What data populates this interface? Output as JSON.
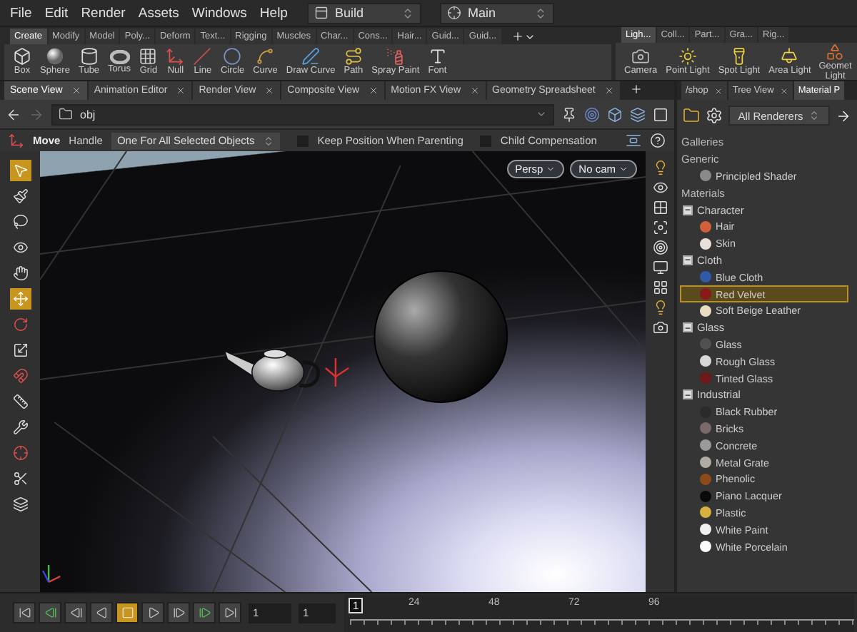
{
  "menu": [
    "File",
    "Edit",
    "Render",
    "Assets",
    "Windows",
    "Help"
  ],
  "dropdowns": [
    {
      "label": "Build"
    },
    {
      "label": "Main"
    }
  ],
  "shelf_tabs": [
    {
      "label": "Create",
      "selected": true
    },
    {
      "label": "Modify",
      "selected": false
    },
    {
      "label": "Model",
      "selected": false
    },
    {
      "label": "Poly...",
      "selected": false
    },
    {
      "label": "Deform",
      "selected": false
    },
    {
      "label": "Text...",
      "selected": false
    },
    {
      "label": "Rigging",
      "selected": false
    },
    {
      "label": "Muscles",
      "selected": false
    },
    {
      "label": "Char...",
      "selected": false
    },
    {
      "label": "Cons...",
      "selected": false
    },
    {
      "label": "Hair...",
      "selected": false
    },
    {
      "label": "Guid...",
      "selected": false
    },
    {
      "label": "Guid...",
      "selected": false
    }
  ],
  "shelf_tools": [
    "Box",
    "Sphere",
    "Tube",
    "Torus",
    "Grid",
    "Null",
    "Line",
    "Circle",
    "Curve",
    "Draw Curve",
    "Path",
    "Spray Paint",
    "Font"
  ],
  "light_shelf_tabs": [
    {
      "label": "Ligh...",
      "selected": true
    },
    {
      "label": "Coll...",
      "selected": false
    },
    {
      "label": "Part...",
      "selected": false
    },
    {
      "label": "Gra...",
      "selected": false
    },
    {
      "label": "Rig...",
      "selected": false
    }
  ],
  "light_tools": [
    "Camera",
    "Point Light",
    "Spot Light",
    "Area Light",
    "Geomet Light"
  ],
  "pane_tabs": [
    {
      "label": "Scene View",
      "selected": true
    },
    {
      "label": "Animation Editor",
      "selected": false
    },
    {
      "label": "Render View",
      "selected": false
    },
    {
      "label": "Composite View",
      "selected": false
    },
    {
      "label": "Motion FX View",
      "selected": false
    },
    {
      "label": "Geometry Spreadsheet",
      "selected": false
    }
  ],
  "path": "obj",
  "operation": {
    "tool": "Move",
    "handle_label": "Handle",
    "mode": "One For All Selected Objects",
    "options": [
      {
        "label": "Keep Position When Parenting",
        "checked": false
      },
      {
        "label": "Child Compensation",
        "checked": false
      }
    ]
  },
  "viewport_tools": [
    {
      "selected": true
    },
    {
      "selected": false
    },
    {
      "selected": false
    },
    {
      "selected": false
    },
    {
      "selected": false
    },
    {
      "selected": true
    },
    {
      "selected": false
    },
    {
      "selected": false
    },
    {
      "selected": false
    },
    {
      "selected": false
    },
    {
      "selected": false
    },
    {
      "selected": false
    },
    {
      "selected": false
    },
    {
      "selected": false
    }
  ],
  "view_buttons": [
    "Persp",
    "No cam"
  ],
  "side_pane": {
    "tabs": [
      {
        "label": "/shop",
        "selected": false
      },
      {
        "label": "Tree View",
        "selected": false
      },
      {
        "label": "Material P",
        "selected": true
      }
    ],
    "renderer": "All Renderers",
    "tree": [
      {
        "kind": "section",
        "label": "Galleries"
      },
      {
        "kind": "section",
        "label": "Generic",
        "children": [
          {
            "kind": "material",
            "label": "Principled Shader",
            "color": "#8a8a8a",
            "selected": false
          }
        ]
      },
      {
        "kind": "section",
        "label": "Materials",
        "children": [
          {
            "kind": "group",
            "label": "Character",
            "expanded": true,
            "children": [
              {
                "kind": "material",
                "label": "Hair",
                "color": "#d0603a",
                "selected": false
              },
              {
                "kind": "material",
                "label": "Skin",
                "color": "#e8e0d8",
                "selected": false
              }
            ]
          },
          {
            "kind": "group",
            "label": "Cloth",
            "expanded": true,
            "children": [
              {
                "kind": "material",
                "label": "Blue Cloth",
                "color": "#2e5aa8",
                "selected": false
              },
              {
                "kind": "material",
                "label": "Red Velvet",
                "color": "#8a1a1a",
                "selected": true
              },
              {
                "kind": "material",
                "label": "Soft Beige Leather",
                "color": "#e8dcc0",
                "selected": false
              }
            ]
          },
          {
            "kind": "group",
            "label": "Glass",
            "expanded": true,
            "children": [
              {
                "kind": "material",
                "label": "Glass",
                "color": "#505050",
                "selected": false
              },
              {
                "kind": "material",
                "label": "Rough Glass",
                "color": "#d8d8d8",
                "selected": false
              },
              {
                "kind": "material",
                "label": "Tinted Glass",
                "color": "#701818",
                "selected": false
              }
            ]
          },
          {
            "kind": "group",
            "label": "Industrial",
            "expanded": true,
            "children": [
              {
                "kind": "material",
                "label": "Black Rubber",
                "color": "#2a2a2a",
                "selected": false
              },
              {
                "kind": "material",
                "label": "Bricks",
                "color": "#7a6a6a",
                "selected": false
              },
              {
                "kind": "material",
                "label": "Concrete",
                "color": "#9a9a9a",
                "selected": false
              },
              {
                "kind": "material",
                "label": "Metal Grate",
                "color": "#b0aca4",
                "selected": false
              },
              {
                "kind": "material",
                "label": "Phenolic",
                "color": "#8a4a1a",
                "selected": false
              },
              {
                "kind": "material",
                "label": "Piano Lacquer",
                "color": "#0a0a0a",
                "selected": false
              },
              {
                "kind": "material",
                "label": "Plastic",
                "color": "#d8b040",
                "selected": false
              },
              {
                "kind": "material",
                "label": "White Paint",
                "color": "#f0f0f0",
                "selected": false
              },
              {
                "kind": "material",
                "label": "White Porcelain",
                "color": "#fafafa",
                "selected": false
              }
            ]
          }
        ]
      }
    ]
  },
  "timeline": {
    "buttons": [
      {
        "selected": false
      },
      {
        "selected": false
      },
      {
        "selected": false
      },
      {
        "selected": false
      },
      {
        "selected": true
      },
      {
        "selected": false
      },
      {
        "selected": false
      },
      {
        "selected": false
      },
      {
        "selected": false
      }
    ],
    "start_field": "1",
    "frame_field": "1",
    "current_frame": "1",
    "ruler_labels": [
      "24",
      "48",
      "72",
      "96"
    ]
  }
}
